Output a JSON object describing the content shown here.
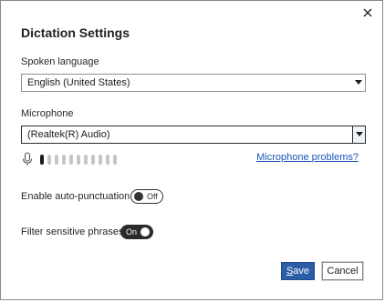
{
  "dialog": {
    "title": "Dictation Settings",
    "close_icon": "close-icon"
  },
  "language": {
    "label": "Spoken language",
    "selected": "English (United States)"
  },
  "microphone": {
    "label": "Microphone",
    "selected": "(Realtek(R) Audio)",
    "level_segments_total": 11,
    "level_segments_active": 1,
    "problems_link": "Microphone problems?"
  },
  "auto_punctuation": {
    "label": "Enable auto-punctuation",
    "state": "Off"
  },
  "filter_phrases": {
    "label": "Filter sensitive phrases",
    "state": "On"
  },
  "buttons": {
    "save_first": "S",
    "save_rest": "ave",
    "cancel": "Cancel"
  },
  "colors": {
    "accent": "#2b5ea7",
    "link": "#1a56b8"
  }
}
